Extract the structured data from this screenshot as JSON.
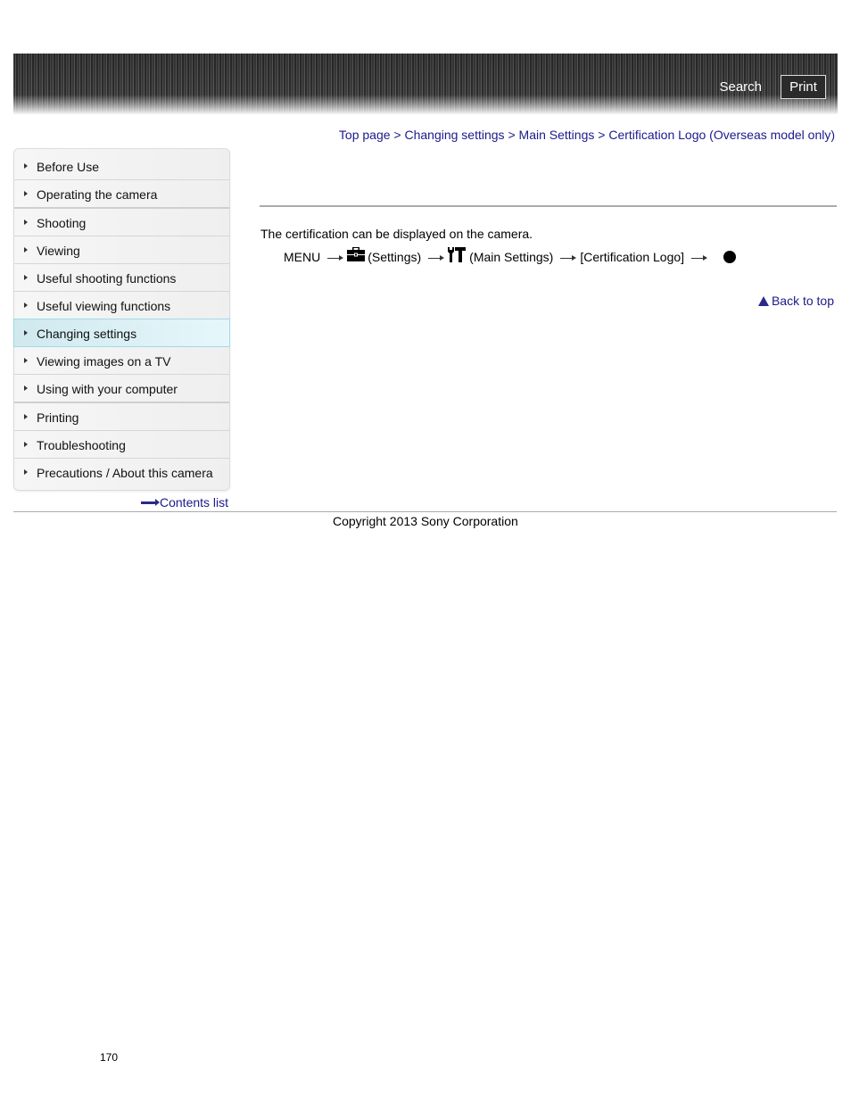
{
  "header": {
    "search_label": "Search",
    "print_label": "Print"
  },
  "breadcrumb": {
    "items": [
      "Top page",
      "Changing settings",
      "Main Settings",
      "Certification Logo (Overseas model only)"
    ],
    "separator": ">"
  },
  "sidebar": {
    "items": [
      {
        "label": "Before Use"
      },
      {
        "label": "Operating the camera"
      },
      {
        "label": "Shooting"
      },
      {
        "label": "Viewing"
      },
      {
        "label": "Useful shooting functions"
      },
      {
        "label": "Useful viewing functions"
      },
      {
        "label": "Changing settings",
        "active": true
      },
      {
        "label": "Viewing images on a TV"
      },
      {
        "label": "Using with your computer"
      },
      {
        "label": "Printing"
      },
      {
        "label": "Troubleshooting"
      },
      {
        "label": "Precautions / About this camera"
      }
    ],
    "contents_link": "Contents list"
  },
  "main": {
    "description": "The certification can be displayed on the camera.",
    "steps": {
      "menu": "MENU",
      "settings": "(Settings)",
      "main_settings": "(Main Settings)",
      "item": "[Certification Logo]",
      "icons": [
        "toolbox-icon",
        "wrench-hammer-icon",
        "filled-circle-icon"
      ]
    },
    "back_to_top": "Back to top"
  },
  "footer": {
    "copyright": "Copyright 2013 Sony Corporation",
    "page_number": "170"
  }
}
